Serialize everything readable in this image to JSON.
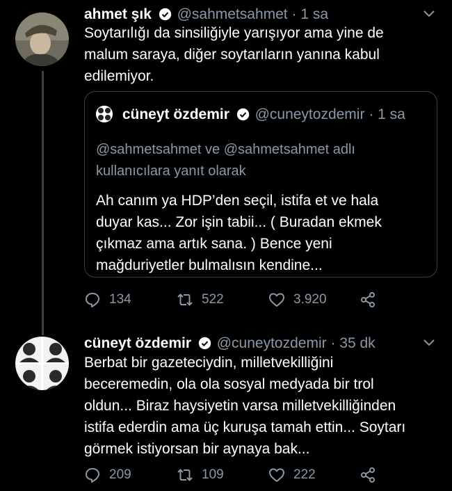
{
  "tweets": [
    {
      "name": "ahmet şık",
      "handle": "@sahmetsahmet",
      "time": "1 sa",
      "text_lines": [
        "Soytarılığı da sinsiliğiyle yarışıyor ama yine de",
        "malum saraya, diğer soytarıların yanına kabul",
        "edilemiyor."
      ],
      "quote": {
        "name": "cüneyt özdemir",
        "handle": "@cuneytozdemir",
        "time": "1 sa",
        "reply_lines": [
          "@sahmetsahmet ve @sahmetsahmet adlı",
          "kullanıcılara yanıt olarak"
        ],
        "text_lines": [
          "Ah canım ya HDP’den seçil, istifa et ve hala",
          "duyar kas... Zor işin tabii... ( Buradan ekmek",
          "çıkmaz ama artık sana. ) Bence yeni",
          "mağduriyetler bulmalısın kendine..."
        ]
      },
      "replies": "134",
      "retweets": "522",
      "likes": "3.920"
    },
    {
      "name": "cüneyt özdemir",
      "handle": "@cuneytozdemir",
      "time": "35 dk",
      "text_lines": [
        "Berbat bir gazeteciydin, milletvekilliğini",
        "beceremedin, ola ola sosyal medyada bir trol",
        "oldun... Biraz haysiyetin varsa milletvekilliğinden",
        "istifa ederdin ama üç kuruşa tamah ettin... Soytarı",
        "görmek istiyorsan bir aynaya bak..."
      ],
      "replies": "209",
      "retweets": "109",
      "likes": "222"
    }
  ],
  "separator": "·",
  "colors": {
    "background": "#000000",
    "secondary_text": "#8b98a5",
    "border": "#3a3f45"
  }
}
